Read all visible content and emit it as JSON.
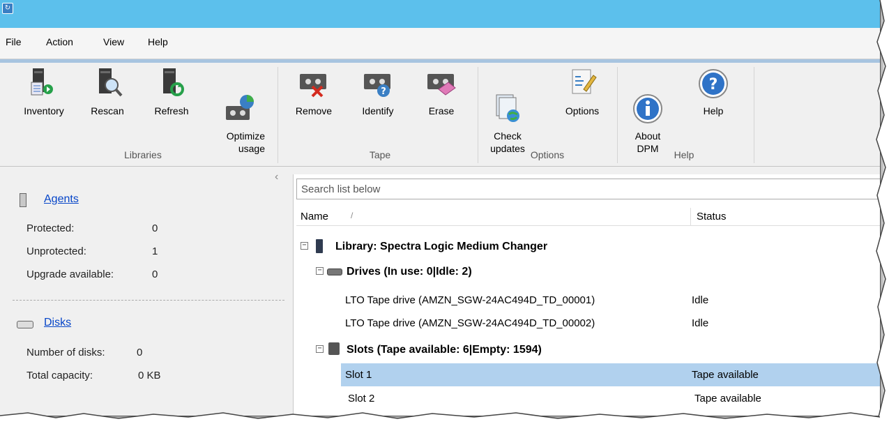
{
  "menu": {
    "items": [
      "File",
      "Action",
      "View",
      "Help"
    ]
  },
  "ribbon": {
    "groups": [
      {
        "label": "Libraries",
        "buttons": [
          {
            "label": "Inventory",
            "icon": "inventory-icon"
          },
          {
            "label": "Rescan",
            "icon": "rescan-icon"
          },
          {
            "label": "Refresh",
            "icon": "refresh-icon"
          },
          {
            "label": "Optimize\nusage",
            "icon": "optimize-usage-icon"
          }
        ]
      },
      {
        "label": "Tape",
        "buttons": [
          {
            "label": "Remove",
            "icon": "remove-tape-icon"
          },
          {
            "label": "Identify",
            "icon": "identify-tape-icon"
          },
          {
            "label": "Erase",
            "icon": "erase-tape-icon"
          }
        ]
      },
      {
        "label": "Options",
        "buttons": [
          {
            "label": "Check\nupdates",
            "icon": "check-updates-icon"
          },
          {
            "label": "Options",
            "icon": "options-icon"
          }
        ]
      },
      {
        "label": "Help",
        "buttons": [
          {
            "label": "About\nDPM",
            "icon": "about-icon"
          },
          {
            "label": "Help",
            "icon": "help-icon"
          }
        ]
      }
    ]
  },
  "left": {
    "agents": {
      "title": "Agents",
      "rows": [
        {
          "label": "Protected:",
          "value": "0"
        },
        {
          "label": "Unprotected:",
          "value": "1"
        },
        {
          "label": "Upgrade available:",
          "value": "0"
        }
      ]
    },
    "disks": {
      "title": "Disks",
      "rows": [
        {
          "label": "Number of disks:",
          "value": "0"
        },
        {
          "label": "Total capacity:",
          "value": "0 KB"
        }
      ]
    }
  },
  "list": {
    "search_placeholder": "Search list below",
    "col_name": "Name",
    "col_sort": "/",
    "col_status": "Status",
    "library": "Library: Spectra Logic Medium Changer",
    "drives_group": "Drives (In use: 0|Idle: 2)",
    "drives": [
      {
        "name": "LTO Tape drive (AMZN_SGW-24AC494D_TD_00001)",
        "status": "Idle"
      },
      {
        "name": "LTO Tape drive (AMZN_SGW-24AC494D_TD_00002)",
        "status": "Idle"
      }
    ],
    "slots_group": "Slots (Tape available: 6|Empty: 1594)",
    "slots": [
      {
        "name": "Slot 1",
        "status": "Tape available",
        "selected": true
      },
      {
        "name": "Slot 2",
        "status": "Tape available",
        "selected": false
      }
    ]
  },
  "colors": {
    "titlebar": "#5cc0ec",
    "selection": "#b1d1ee",
    "link": "#0645c8"
  }
}
